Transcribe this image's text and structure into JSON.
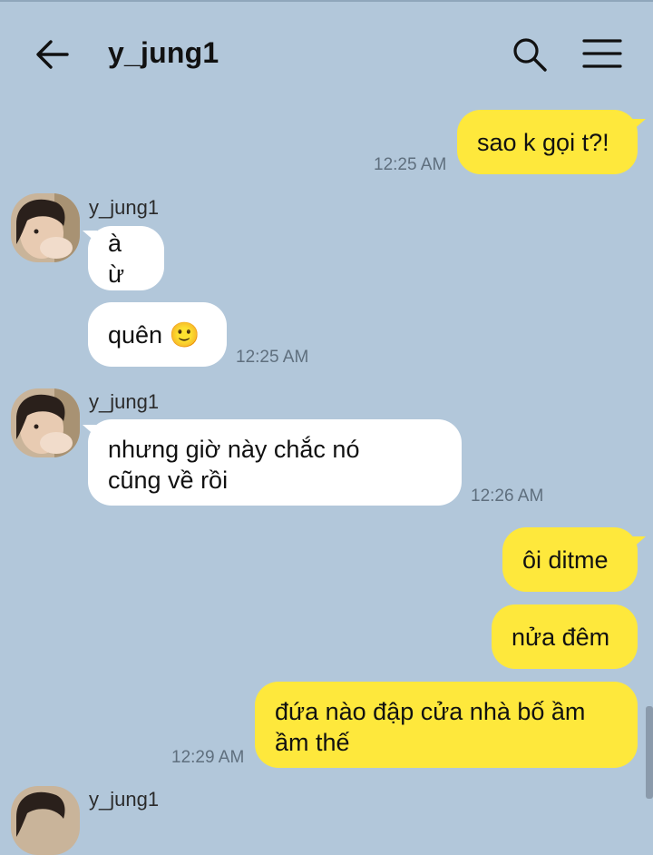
{
  "header": {
    "title": "y_jung1"
  },
  "messages": {
    "m1": {
      "text": "sao k gọi t?!",
      "time": "12:25 AM"
    },
    "g1": {
      "sender": "y_jung1",
      "b1": "à ừ",
      "b2": "quên 🙂",
      "time": "12:25 AM"
    },
    "g2": {
      "sender": "y_jung1",
      "line1": "nhưng giờ này chắc nó",
      "line2": "cũng về rồi",
      "time": "12:26 AM"
    },
    "m2": {
      "text": "ôi ditme"
    },
    "m3": {
      "text": "nửa đêm"
    },
    "m4": {
      "line1": "đứa nào đập cửa nhà bố ầm",
      "line2": "ầm thế",
      "time": "12:29 AM"
    },
    "g3": {
      "sender": "y_jung1"
    }
  },
  "colors": {
    "background": "#b2c7da",
    "my_bubble": "#fee83c",
    "their_bubble": "#ffffff"
  },
  "icons": {
    "back": "arrow-left-icon",
    "search": "search-icon",
    "menu": "hamburger-menu-icon"
  }
}
